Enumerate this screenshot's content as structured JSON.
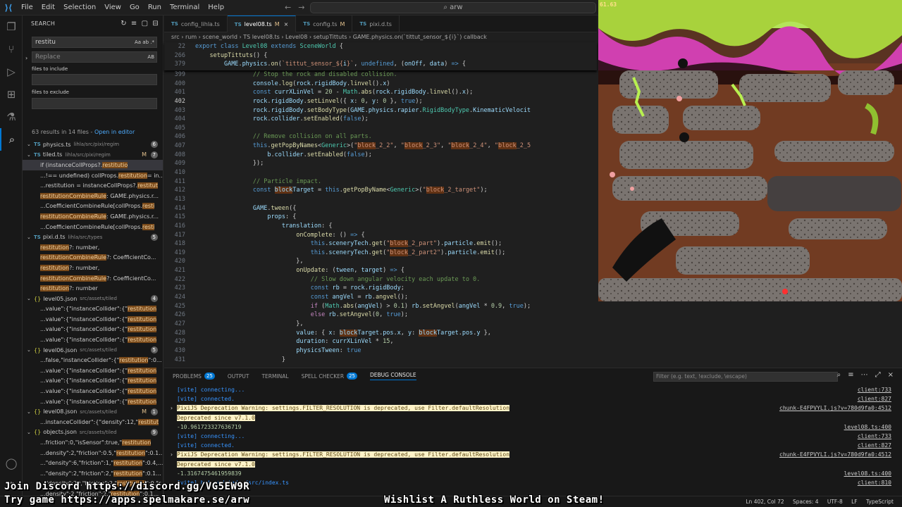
{
  "menu": [
    "File",
    "Edit",
    "Selection",
    "View",
    "Go",
    "Run",
    "Terminal",
    "Help"
  ],
  "command_center": "arw",
  "search": {
    "title": "SEARCH",
    "query": "restitu",
    "replace_placeholder": "Replace",
    "replace_opt": "AB",
    "query_opts": "Aa ab .*",
    "include_label": "files to include",
    "exclude_label": "files to exclude",
    "summary": "63 results in 14 files - ",
    "open_in_editor": "Open in editor"
  },
  "results": [
    {
      "kind": "file",
      "icon": "TS",
      "name": "physics.ts",
      "path": "lihla/src/pixi/regim",
      "count": "6"
    },
    {
      "kind": "file",
      "icon": "TS",
      "name": "tiled.ts",
      "path": "lihla/src/pixi/regim",
      "count": "7",
      "mod": "M"
    },
    {
      "kind": "match",
      "pre": "if (instanceCollProps?.",
      "hit": "restitutio",
      "post": "",
      "sel": true
    },
    {
      "kind": "match",
      "pre": "...!== undefined) collProps.",
      "hit": "restitution",
      "post": " = in..."
    },
    {
      "kind": "match",
      "pre": "...restitution = instanceCollProps?.",
      "hit": "restitut",
      "post": ""
    },
    {
      "kind": "match",
      "pre": "",
      "hit": "restitutionCombineRule",
      "post": ": GAME.physics.r..."
    },
    {
      "kind": "match",
      "pre": "...CoefficientCombineRule[collProps.",
      "hit": "resti",
      "post": ""
    },
    {
      "kind": "match",
      "pre": "",
      "hit": "restitutionCombineRule",
      "post": ": GAME.physics.r..."
    },
    {
      "kind": "match",
      "pre": "...CoefficientCombineRule[collProps.",
      "hit": "resti",
      "post": ""
    },
    {
      "kind": "file",
      "icon": "TS",
      "name": "pixi.d.ts",
      "path": "lihla/src/types",
      "count": "5"
    },
    {
      "kind": "match",
      "pre": "",
      "hit": "restitution",
      "post": "?: number,"
    },
    {
      "kind": "match",
      "pre": "",
      "hit": "restitutionCombineRule",
      "post": "?: CoefficientCo..."
    },
    {
      "kind": "match",
      "pre": "",
      "hit": "restitution",
      "post": "?: number,"
    },
    {
      "kind": "match",
      "pre": "",
      "hit": "restitutionCombineRule",
      "post": "?: CoefficientCo..."
    },
    {
      "kind": "match",
      "pre": "",
      "hit": "restitution",
      "post": "?: number"
    },
    {
      "kind": "file",
      "icon": "{}",
      "name": "level05.json",
      "path": "src/assets/tiled",
      "count": "4"
    },
    {
      "kind": "match",
      "pre": "...value\":{\"instanceCollider\":{\"",
      "hit": "restitution",
      "post": ""
    },
    {
      "kind": "match",
      "pre": "...value\":{\"instanceCollider\":{\"",
      "hit": "restitution",
      "post": ""
    },
    {
      "kind": "match",
      "pre": "...value\":{\"instanceCollider\":{\"",
      "hit": "restitution",
      "post": ""
    },
    {
      "kind": "match",
      "pre": "...value\":{\"instanceCollider\":{\"",
      "hit": "restitution",
      "post": ""
    },
    {
      "kind": "file",
      "icon": "{}",
      "name": "level06.json",
      "path": "src/assets/tiled",
      "count": "5"
    },
    {
      "kind": "match",
      "pre": "...false,\"instanceCollider\":{\"",
      "hit": "restitution",
      "post": "\":0..."
    },
    {
      "kind": "match",
      "pre": "...value\":{\"instanceCollider\":{\"",
      "hit": "restitution",
      "post": ""
    },
    {
      "kind": "match",
      "pre": "...value\":{\"instanceCollider\":{\"",
      "hit": "restitution",
      "post": ""
    },
    {
      "kind": "match",
      "pre": "...value\":{\"instanceCollider\":{\"",
      "hit": "restitution",
      "post": ""
    },
    {
      "kind": "match",
      "pre": "...value\":{\"instanceCollider\":{\"",
      "hit": "restitution",
      "post": ""
    },
    {
      "kind": "file",
      "icon": "{}",
      "name": "level08.json",
      "path": "src/assets/tiled",
      "count": "1",
      "mod": "M"
    },
    {
      "kind": "match",
      "pre": "...instanceCollider\":{\"density\":12,\"",
      "hit": "restitut",
      "post": ""
    },
    {
      "kind": "file",
      "icon": "{}",
      "name": "objects.json",
      "path": "src/assets/tiled",
      "count": "9"
    },
    {
      "kind": "match",
      "pre": "...friction\":0,\"isSensor\":true,\"",
      "hit": "restitution",
      "post": ""
    },
    {
      "kind": "match",
      "pre": "...density\":2,\"friction\":0.5,\"",
      "hit": "restitution",
      "post": "\":0.1..."
    },
    {
      "kind": "match",
      "pre": "...\"density\":6,\"friction\":1,\"",
      "hit": "restitution",
      "post": "\":0.4,..."
    },
    {
      "kind": "match",
      "pre": "...\"density\":2,\"friction\":2,\"",
      "hit": "restitution",
      "post": "\":0.1..."
    },
    {
      "kind": "match",
      "pre": "...\"density\":20,\"friction\":2,\"",
      "hit": "restitution",
      "post": "\":0,\"r..."
    },
    {
      "kind": "match",
      "pre": "...density\":2,\"friction\":2,\"",
      "hit": "restitution",
      "post": "\":0.1..."
    }
  ],
  "tabs": [
    {
      "name": "config_lihla.ts",
      "mod": "",
      "active": false
    },
    {
      "name": "level08.ts",
      "mod": "M",
      "active": true
    },
    {
      "name": "config.ts",
      "mod": "M",
      "active": false
    },
    {
      "name": "pixi.d.ts",
      "mod": "",
      "active": false
    }
  ],
  "breadcrumb": "src › rum › scene_world › TS level08.ts › Level08 › setupTittuts › GAME.physics.on(`tittut_sensor_${i}`) callback",
  "sticky": [
    {
      "ln": "22",
      "code": "<span class='k'>export</span> <span class='k'>class</span> <span class='t'>Level08</span> <span class='k'>extends</span> <span class='t'>SceneWorld</span> {"
    },
    {
      "ln": "266",
      "code": "    <span class='f'>setupTittuts</span>() {"
    },
    {
      "ln": "379",
      "code": "        <span class='v'>GAME</span>.<span class='v'>physics</span>.<span class='f'>on</span>(<span class='s'>`tittut_sensor_${</span><span class='v'>i</span><span class='s'>}`</span>, <span class='k'>undefined</span>, (<span class='v'>onOff</span>, <span class='v'>data</span>) <span class='k'>=></span> {"
    }
  ],
  "code": [
    {
      "ln": "399",
      "code": "                <span class='c'>// Stop the rock and disabled collision.</span>"
    },
    {
      "ln": "400",
      "code": "                <span class='v'>console</span>.<span class='f'>log</span>(<span class='v'>rock</span>.<span class='v'>rigidBody</span>.<span class='f'>linvel</span>().<span class='v'>x</span>)"
    },
    {
      "ln": "401",
      "code": "                <span class='k'>const</span> <span class='v'>currXLinVel</span> = <span class='n'>20</span> - <span class='t'>Math</span>.<span class='f'>abs</span>(<span class='v'>rock</span>.<span class='v'>rigidBody</span>.<span class='f'>linvel</span>().<span class='v'>x</span>);"
    },
    {
      "ln": "402",
      "code": "                <span class='v'>rock</span>.<span class='v'>rigidBody</span>.<span class='f'>setLinvel</span>({ <span class='v'>x</span>: <span class='n'>0</span>, <span class='v'>y</span>: <span class='n'>0</span> }, <span class='k'>true</span>);",
      "cur": true
    },
    {
      "ln": "403",
      "code": "                <span class='v'>rock</span>.<span class='v'>rigidBody</span>.<span class='f'>setBodyType</span>(<span class='v'>GAME</span>.<span class='v'>physics</span>.<span class='v'>rapier</span>.<span class='t'>RigidBodyType</span>.<span class='v'>KinematicVelocit</span>"
    },
    {
      "ln": "404",
      "code": "                <span class='v'>rock</span>.<span class='v'>collider</span>.<span class='f'>setEnabled</span>(<span class='k'>false</span>);"
    },
    {
      "ln": "405",
      "code": ""
    },
    {
      "ln": "406",
      "code": "                <span class='c'>// Remove collision on all parts.</span>"
    },
    {
      "ln": "407",
      "code": "                <span class='k'>this</span>.<span class='f'>getPopByNames</span>&lt;<span class='t'>Generic</span>&gt;(<span class='s'>\"<span class='shl'>block</span>_2_2\"</span>, <span class='s'>\"<span class='shl'>block</span>_2_3\"</span>, <span class='s'>\"<span class='shl'>block</span>_2_4\"</span>, <span class='s'>\"<span class='shl'>block</span>_2_5</span>"
    },
    {
      "ln": "408",
      "code": "                    <span class='v'>b</span>.<span class='v'>collider</span>.<span class='f'>setEnabled</span>(<span class='k'>false</span>);"
    },
    {
      "ln": "409",
      "code": "                });"
    },
    {
      "ln": "410",
      "code": ""
    },
    {
      "ln": "411",
      "code": "                <span class='c'>// Particle impact.</span>"
    },
    {
      "ln": "412",
      "code": "                <span class='k'>const</span> <span class='v shl'>block</span><span class='v'>Target</span> = <span class='k'>this</span>.<span class='f'>getPopByName</span>&lt;<span class='t'>Generic</span>&gt;(<span class='s'>\"<span class='shl'>block</span>_2_target\"</span>);"
    },
    {
      "ln": "413",
      "code": ""
    },
    {
      "ln": "414",
      "code": "                <span class='v'>GAME</span>.<span class='f'>tween</span>({"
    },
    {
      "ln": "415",
      "code": "                    <span class='v'>props</span>: {"
    },
    {
      "ln": "416",
      "code": "                        <span class='v'>translation</span>: {"
    },
    {
      "ln": "417",
      "code": "                            <span class='f'>onComplete</span>: () <span class='k'>=></span> {"
    },
    {
      "ln": "418",
      "code": "                                <span class='k'>this</span>.<span class='v'>sceneryTech</span>.<span class='f'>get</span>(<span class='s'>\"<span class='shl'>block</span>_2_part\"</span>).<span class='v'>particle</span>.<span class='f'>emit</span>();"
    },
    {
      "ln": "419",
      "code": "                                <span class='k'>this</span>.<span class='v'>sceneryTech</span>.<span class='f'>get</span>(<span class='s'>\"<span class='shl'>block</span>_2_part2\"</span>).<span class='v'>particle</span>.<span class='f'>emit</span>();"
    },
    {
      "ln": "420",
      "code": "                            },"
    },
    {
      "ln": "421",
      "code": "                            <span class='f'>onUpdate</span>: (<span class='v'>tween</span>, <span class='v'>target</span>) <span class='k'>=></span> {"
    },
    {
      "ln": "422",
      "code": "                                <span class='c'>// Slow down angular velocity each update to 0.</span>"
    },
    {
      "ln": "423",
      "code": "                                <span class='k'>const</span> <span class='v'>rb</span> = <span class='v'>rock</span>.<span class='v'>rigidBody</span>;"
    },
    {
      "ln": "424",
      "code": "                                <span class='k'>const</span> <span class='v'>angVel</span> = <span class='v'>rb</span>.<span class='f'>angvel</span>();"
    },
    {
      "ln": "425",
      "code": "                                <span class='kc'>if</span> (<span class='t'>Math</span>.<span class='f'>abs</span>(<span class='v'>angVel</span>) &gt; <span class='n'>0.1</span>) <span class='v'>rb</span>.<span class='f'>setAngvel</span>(<span class='v'>angVel</span> * <span class='n'>0.9</span>, <span class='k'>true</span>);"
    },
    {
      "ln": "426",
      "code": "                                <span class='kc'>else</span> <span class='v'>rb</span>.<span class='f'>setAngvel</span>(<span class='n'>0</span>, <span class='k'>true</span>);"
    },
    {
      "ln": "427",
      "code": "                            },"
    },
    {
      "ln": "428",
      "code": "                            <span class='v'>value</span>: { <span class='v'>x</span>: <span class='v shl'>block</span><span class='v'>Target</span>.<span class='v'>pos</span>.<span class='v'>x</span>, <span class='v'>y</span>: <span class='v shl'>block</span><span class='v'>Target</span>.<span class='v'>pos</span>.<span class='v'>y</span> },"
    },
    {
      "ln": "429",
      "code": "                            <span class='v'>duration</span>: <span class='v'>currXLinVel</span> * <span class='n'>15</span>,"
    },
    {
      "ln": "430",
      "code": "                            <span class='v'>physicsTween</span>: <span class='k'>true</span>"
    },
    {
      "ln": "431",
      "code": "                        }"
    }
  ],
  "game": {
    "fps": "61.63"
  },
  "panel": {
    "tabs": [
      {
        "label": "PROBLEMS",
        "badge": "25"
      },
      {
        "label": "OUTPUT",
        "badge": ""
      },
      {
        "label": "TERMINAL",
        "badge": ""
      },
      {
        "label": "SPELL CHECKER",
        "badge": "25"
      },
      {
        "label": "DEBUG CONSOLE",
        "badge": "",
        "active": true
      }
    ],
    "filter_placeholder": "Filter (e.g. text, !exclude, \\escape)",
    "logs": [
      {
        "type": "msg",
        "text": "[vite] connecting...",
        "src": "client:733"
      },
      {
        "type": "msg",
        "text": "[vite] connected.",
        "src": "client:827"
      },
      {
        "type": "warn",
        "text": "PixiJS Deprecation Warning: settings.FILTER_RESOLUTION is deprecated, use Filter.defaultResolution",
        "src": "chunk-E4FPVYLI.js?v=780d9fa0:4512",
        "tw": true
      },
      {
        "type": "warn",
        "text": "Deprecated since v7.1.0",
        "src": ""
      },
      {
        "type": "num",
        "text": "-10.961723327636719",
        "src": "level08.ts:400"
      },
      {
        "type": "msg",
        "text": "[vite] connecting...",
        "src": "client:733"
      },
      {
        "type": "msg",
        "text": "[vite] connected.",
        "src": "client:827"
      },
      {
        "type": "warn",
        "text": "PixiJS Deprecation Warning: settings.FILTER_RESOLUTION is deprecated, use Filter.defaultResolution",
        "src": "chunk-E4FPVYLI.js?v=780d9fa0:4512",
        "tw": true
      },
      {
        "type": "warn",
        "text": "Deprecated since v7.1.0",
        "src": ""
      },
      {
        "type": "num",
        "text": "-1.3167475461959839",
        "src": "level08.ts:400"
      },
      {
        "type": "msg",
        "text": "[vite] hot updated: /src/index.ts",
        "src": "client:810"
      }
    ]
  },
  "status": {
    "pos": "Ln 402, Col 72",
    "spaces": "Spaces: 4",
    "enc": "UTF-8",
    "eol": "LF",
    "lang": "TypeScript"
  },
  "overlays": {
    "discord": "Join Discord https://discord.gg/VG5EW9R",
    "try": "Try game https://apps.spelmakare.se/arw",
    "wishlist": "Wishlist A Ruthless World on Steam!"
  }
}
